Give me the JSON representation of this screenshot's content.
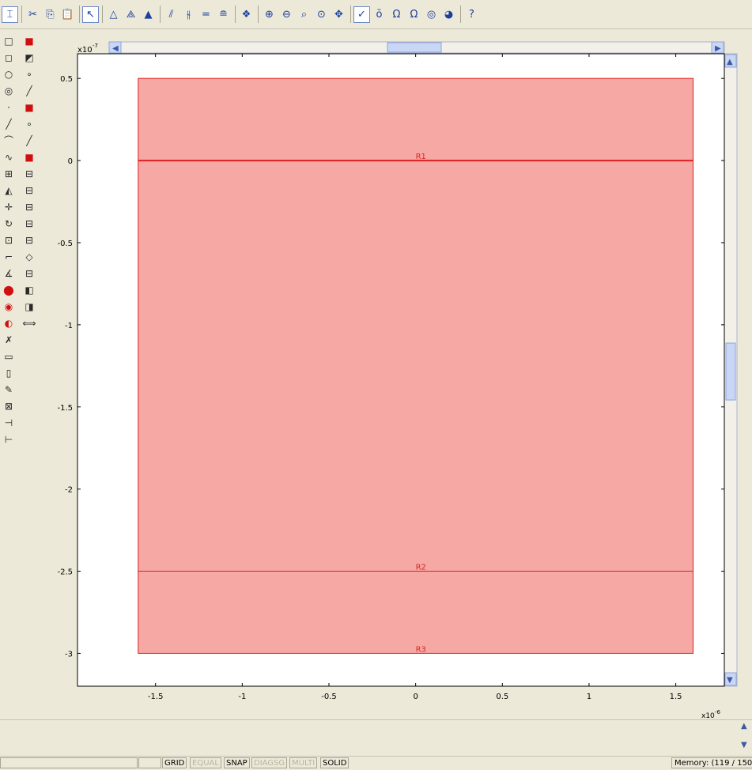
{
  "toolbar": {
    "buttons": [
      {
        "name": "pointer-mode-icon",
        "glyph": "⌶"
      },
      {
        "name": "cut-icon",
        "glyph": "✂"
      },
      {
        "name": "copy-icon",
        "glyph": "⎘"
      },
      {
        "name": "paste-icon",
        "glyph": "📋"
      },
      {
        "name": "select-arrow-icon",
        "glyph": "↖"
      },
      {
        "name": "triangle-icon",
        "glyph": "△"
      },
      {
        "name": "triangle-refine-icon",
        "glyph": "⟁"
      },
      {
        "name": "triangle-green-icon",
        "glyph": "▲"
      },
      {
        "name": "mesh-one-icon",
        "glyph": "⫽"
      },
      {
        "name": "mesh-two-icon",
        "glyph": "⫳"
      },
      {
        "name": "equal-icon",
        "glyph": "="
      },
      {
        "name": "equation-icon",
        "glyph": "≘"
      },
      {
        "name": "solve-icon",
        "glyph": "❖"
      },
      {
        "name": "zoom-in-icon",
        "glyph": "⊕"
      },
      {
        "name": "zoom-out-icon",
        "glyph": "⊖"
      },
      {
        "name": "zoom-window-icon",
        "glyph": "⌕"
      },
      {
        "name": "zoom-extents-icon",
        "glyph": "⊙"
      },
      {
        "name": "pan-icon",
        "glyph": "✥"
      },
      {
        "name": "plot-check-icon",
        "glyph": "✓"
      },
      {
        "name": "subdomain-icon",
        "glyph": "ŏ"
      },
      {
        "name": "boundary-icon",
        "glyph": "Ω"
      },
      {
        "name": "omega-icon",
        "glyph": "Ω"
      },
      {
        "name": "sphere-icon",
        "glyph": "◎"
      },
      {
        "name": "color-map-icon",
        "glyph": "◕"
      },
      {
        "name": "help-icon",
        "glyph": "?"
      }
    ]
  },
  "left_tools": {
    "col1": [
      "□",
      "◻",
      "○",
      "◎",
      "·",
      "╱",
      "⌒",
      "∿",
      "⊞",
      "◭",
      "✛",
      "↻",
      "⊡",
      "⌐",
      "∡",
      "⬤",
      "◉",
      "◐",
      "✗",
      "▭",
      "▯",
      "✎",
      "⊠",
      "⊣",
      "⊢"
    ],
    "col2": [
      "■",
      "◩",
      "∘",
      "╱",
      "■",
      "∘",
      "╱",
      "■",
      "⊟",
      "⊟",
      "⊟",
      "⊟",
      "⊟",
      "◇",
      "⊟",
      "◧",
      "◨",
      "⟺"
    ]
  },
  "plot": {
    "y_exponent": "x10",
    "y_exponent_sup": "-7",
    "x_exponent": "x10",
    "x_exponent_sup": "-6",
    "xlim": [
      -1.95,
      1.78
    ],
    "ylim": [
      -3.2,
      0.65
    ],
    "xticks": [
      "-1.5",
      "-1",
      "-0.5",
      "0",
      "0.5",
      "1",
      "1.5"
    ],
    "xtick_values": [
      -1.5,
      -1,
      -0.5,
      0,
      0.5,
      1,
      1.5
    ],
    "yticks": [
      "0.5",
      "0",
      "-0.5",
      "-1",
      "-1.5",
      "-2",
      "-2.5",
      "-3"
    ],
    "ytick_values": [
      0.5,
      0,
      -0.5,
      -1,
      -1.5,
      -2,
      -2.5,
      -3
    ],
    "rect": {
      "x0": -1.6,
      "x1": 1.6,
      "y0": -3,
      "y1": 0.5
    },
    "regions": [
      {
        "label": "R1",
        "x": 0.03,
        "y": 0.0,
        "color": "#d8281e"
      },
      {
        "label": "R2",
        "x": 0.03,
        "y": -2.5,
        "color": "#d8281e"
      },
      {
        "label": "R3",
        "x": 0.03,
        "y": -3.0,
        "color": "#d8281e"
      }
    ],
    "fill_color": "#f5a8a4",
    "edge_color": "#e02020"
  },
  "status": {
    "grid": "GRID",
    "equal": "EQUAL",
    "snap": "SNAP",
    "diagsg": "DIAGSG",
    "multi": "MULTI",
    "solid": "SOLID",
    "memory": "Memory: (119 / 150"
  }
}
